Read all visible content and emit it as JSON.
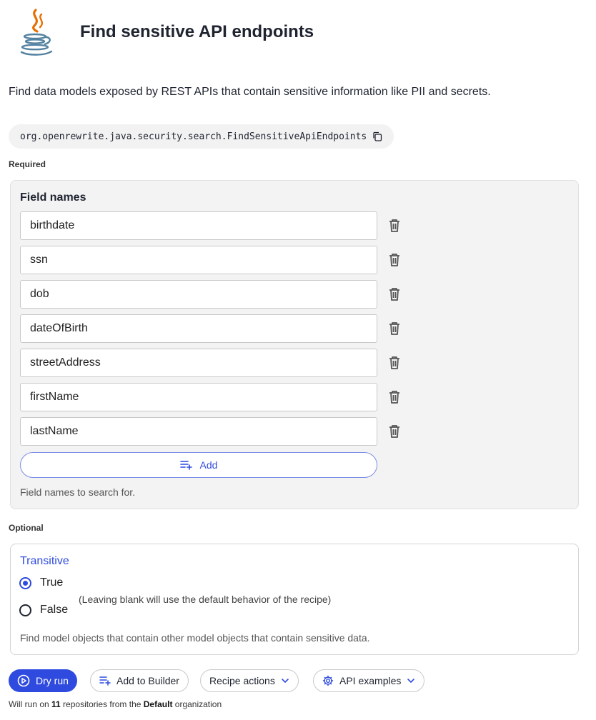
{
  "header": {
    "logo_icon": "java-coffee-cup-icon",
    "title": "Find sensitive API endpoints"
  },
  "description": "Find data models exposed by REST APIs that contain sensitive information like PII and secrets.",
  "recipe": {
    "id": "org.openrewrite.java.security.search.FindSensitiveApiEndpoints",
    "copy_icon": "copy-icon"
  },
  "required": {
    "section_label": "Required",
    "field_title": "Field names",
    "fields": [
      "birthdate",
      "ssn",
      "dob",
      "dateOfBirth",
      "streetAddress",
      "firstName",
      "lastName"
    ],
    "delete_icon": "trash-icon",
    "add_label": "Add",
    "add_icon": "playlist-add-icon",
    "help": "Field names to search for."
  },
  "optional": {
    "section_label": "Optional",
    "transitive_title": "Transitive",
    "options": [
      {
        "label": "True",
        "checked": true
      },
      {
        "label": "False",
        "checked": false
      }
    ],
    "hint": "(Leaving blank will use the default behavior of the recipe)",
    "help": "Find model objects that contain other model objects that contain sensitive data."
  },
  "actions": {
    "dry_run": "Dry run",
    "add_to_builder": "Add to Builder",
    "recipe_actions": "Recipe actions",
    "api_examples": "API examples"
  },
  "footer": {
    "prefix": "Will run on ",
    "count": "11",
    "middle": " repositories from the ",
    "org": "Default",
    "suffix": " organization"
  },
  "colors": {
    "accent": "#2f4bdf",
    "panel_bg": "#f3f3f3"
  }
}
